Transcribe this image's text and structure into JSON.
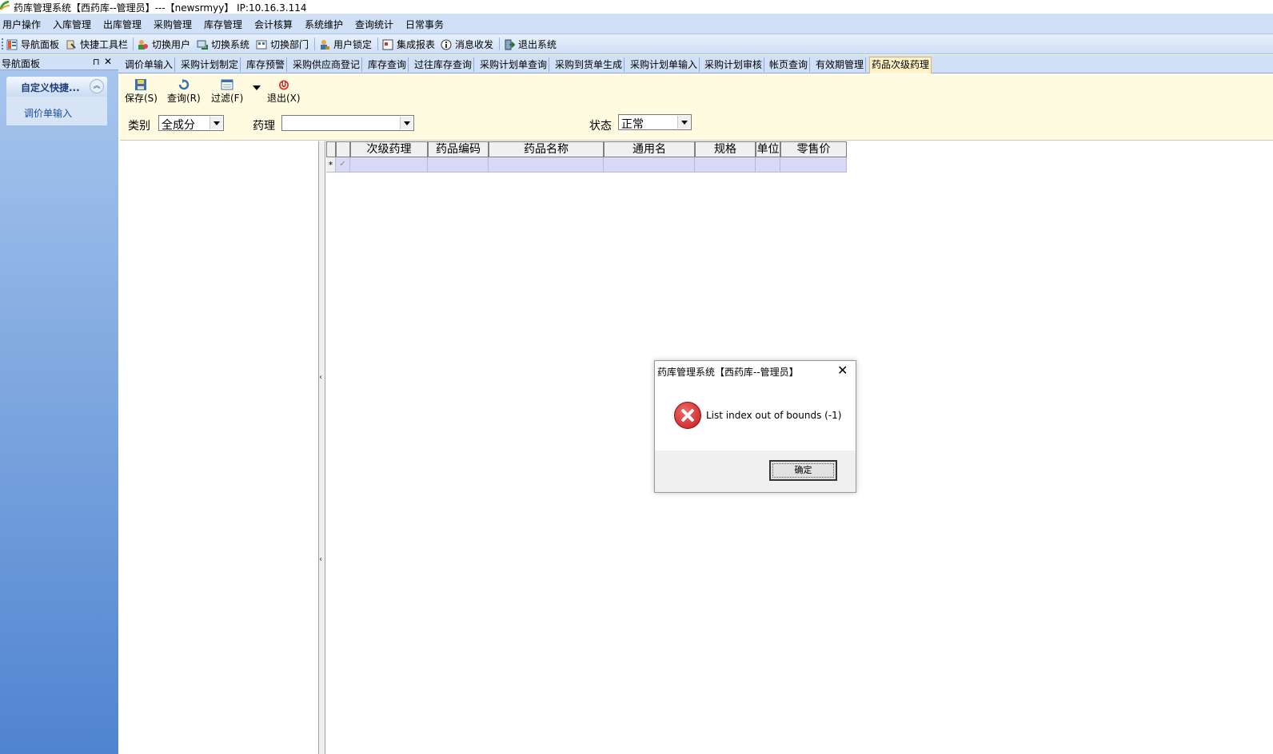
{
  "window": {
    "title": "药库管理系统【西药库--管理员】---【newsrmyy】 IP:10.16.3.114"
  },
  "menu": [
    "用户操作",
    "入库管理",
    "出库管理",
    "采购管理",
    "库存管理",
    "会计核算",
    "系统维护",
    "查询统计",
    "日常事务"
  ],
  "toolbar": [
    {
      "label": "导航面板",
      "icon": "navigation-panel-icon"
    },
    {
      "label": "快捷工具栏",
      "icon": "shortcut-toolbar-icon"
    },
    {
      "label": "切换用户",
      "icon": "switch-user-icon"
    },
    {
      "label": "切换系统",
      "icon": "switch-system-icon"
    },
    {
      "label": "切换部门",
      "icon": "switch-department-icon"
    },
    {
      "label": "用户锁定",
      "icon": "user-lock-icon"
    },
    {
      "label": "集成报表",
      "icon": "report-icon"
    },
    {
      "label": "消息收发",
      "icon": "info-icon"
    },
    {
      "label": "退出系统",
      "icon": "exit-icon"
    }
  ],
  "nav": {
    "header": "导航面板",
    "group": "自定义快捷...",
    "items": [
      "调价单输入"
    ]
  },
  "tabs": [
    "调价单输入",
    "采购计划制定",
    "库存预警",
    "采购供应商登记",
    "库存查询",
    "过往库存查询",
    "采购计划单查询",
    "采购到货单生成",
    "采购计划单输入",
    "采购计划审核",
    "帐页查询",
    "有效期管理",
    "药品次级药理"
  ],
  "active_tab": "药品次级药理",
  "actions": [
    {
      "label": "保存(S)",
      "icon": "save-icon"
    },
    {
      "label": "查询(R)",
      "icon": "refresh-icon"
    },
    {
      "label": "过滤(F)",
      "icon": "filter-icon"
    },
    {
      "label": "退出(X)",
      "icon": "power-icon"
    }
  ],
  "filters": {
    "category_label": "类别",
    "category_value": "全成分",
    "pharmacology_label": "药理",
    "pharmacology_value": "",
    "status_label": "状态",
    "status_value": "正常"
  },
  "grid": {
    "columns": [
      "次级药理",
      "药品编码",
      "药品名称",
      "通用名",
      "规格",
      "单位",
      "零售价"
    ],
    "new_row_marker": "*",
    "check_mark": "✓"
  },
  "dialog": {
    "title": "药库管理系统【西药库--管理员】",
    "message": "List index out of bounds (-1)",
    "ok": "确定"
  },
  "colors": {
    "menubar": "#cfe0f7",
    "content_toolbar": "#fffbe0",
    "active_tab": "#fff3c7",
    "grid_row": "#d9d9f5",
    "error": "#c21b1b"
  }
}
